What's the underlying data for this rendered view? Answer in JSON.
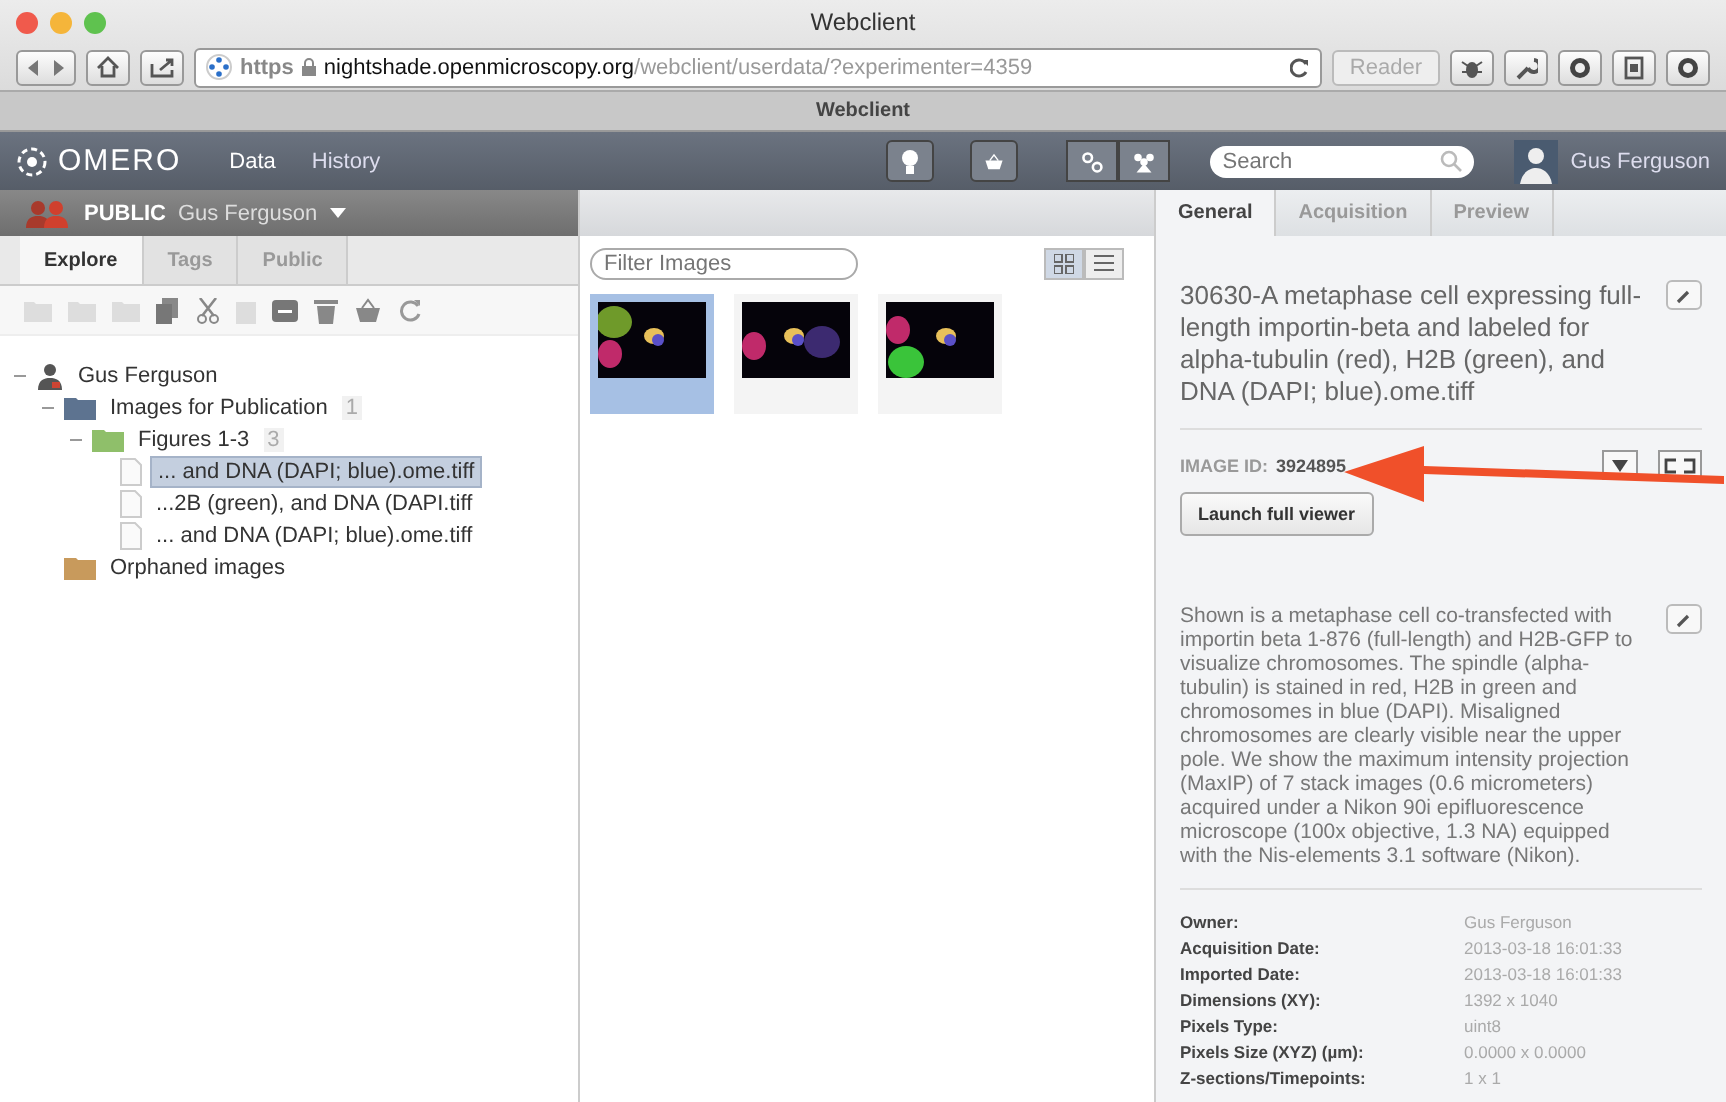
{
  "browser": {
    "title": "Webclient",
    "url_scheme": "https",
    "url_host": "nightshade.openmicroscopy.org",
    "url_path": "/webclient/userdata/?experimenter=4359",
    "reader": "Reader",
    "tab": "Webclient"
  },
  "app": {
    "logo": "OMERO",
    "nav": [
      {
        "label": "Data",
        "selected": true
      },
      {
        "label": "History",
        "selected": false
      }
    ],
    "search": {
      "placeholder": "Search"
    },
    "user": "Gus Ferguson"
  },
  "group": {
    "name": "PUBLIC",
    "user": "Gus Ferguson"
  },
  "left_tabs": [
    {
      "label": "Explore",
      "selected": true
    },
    {
      "label": "Tags",
      "selected": false
    },
    {
      "label": "Public",
      "selected": false
    }
  ],
  "tree": [
    {
      "label": "Gus Ferguson",
      "kind": "user",
      "expanded": true,
      "children": [
        {
          "label": "Images for Publication",
          "count": "1",
          "kind": "project",
          "expanded": true,
          "children": [
            {
              "label": "Figures 1-3",
              "count": "3",
              "kind": "dataset",
              "expanded": true,
              "children": [
                {
                  "label": "... and DNA (DAPI; blue).ome.tiff",
                  "kind": "image",
                  "selected": true
                },
                {
                  "label": "...2B (green), and DNA (DAPI.tiff",
                  "kind": "image",
                  "selected": false
                },
                {
                  "label": "... and DNA (DAPI; blue).ome.tiff",
                  "kind": "image",
                  "selected": false
                }
              ]
            }
          ]
        },
        {
          "label": "Orphaned images",
          "kind": "orphaned"
        }
      ]
    }
  ],
  "filter": {
    "placeholder": "Filter Images"
  },
  "thumbnails": [
    {
      "selected": true
    },
    {
      "selected": false
    },
    {
      "selected": false
    }
  ],
  "right_tabs": [
    {
      "label": "General",
      "selected": true
    },
    {
      "label": "Acquisition",
      "selected": false
    },
    {
      "label": "Preview",
      "selected": false
    }
  ],
  "image": {
    "name": "30630-A metaphase cell expressing full-length importin-beta and labeled for alpha-tubulin (red), H2B (green), and DNA (DAPI; blue).ome.tiff",
    "id_label": "IMAGE ID:",
    "id": "3924895",
    "launch": "Launch full viewer",
    "description": "Shown is a metaphase cell co-transfected with importin beta 1-876 (full-length) and H2B-GFP to visualize chromosomes. The spindle (alpha-tubulin) is stained in red, H2B in green and chromosomes in blue (DAPI). Misaligned chromosomes are clearly visible near the upper pole. We show the maximum intensity projection (MaxIP) of 7 stack images (0.6 micrometers) acquired under a Nikon 90i epifluorescence microscope (100x objective, 1.3 NA) equipped with the Nis-elements 3.1 software (Nikon).",
    "properties": [
      {
        "label": "Owner:",
        "value": "Gus Ferguson"
      },
      {
        "label": "Acquisition Date:",
        "value": "2013-03-18 16:01:33"
      },
      {
        "label": "Imported Date:",
        "value": "2013-03-18 16:01:33"
      },
      {
        "label": "Dimensions (XY):",
        "value": "1392 x 1040"
      },
      {
        "label": "Pixels Type:",
        "value": "uint8"
      },
      {
        "label": "Pixels Size (XYZ) (µm):",
        "value": "0.0000 x 0.0000"
      },
      {
        "label": "Z-sections/Timepoints:",
        "value": "1 x 1"
      }
    ]
  }
}
